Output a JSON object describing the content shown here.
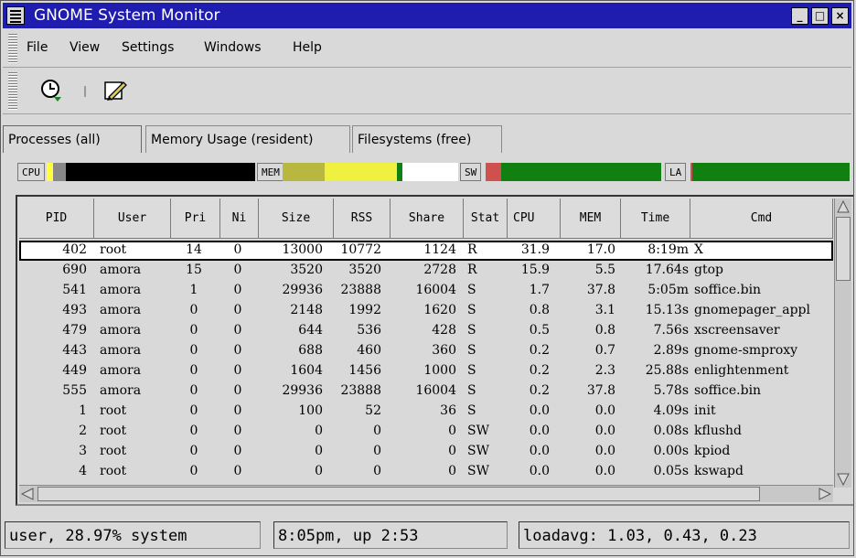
{
  "window": {
    "title": "GNOME System Monitor",
    "controls": [
      "_",
      "□",
      "×"
    ]
  },
  "menubar": {
    "items": [
      {
        "label": "File"
      },
      {
        "label": "View"
      },
      {
        "label": "Settings"
      },
      {
        "label": "Windows"
      },
      {
        "label": "Help"
      }
    ]
  },
  "toolbar": {
    "buttons": [
      {
        "icon": "clock-icon"
      },
      {
        "icon": "pencil-edit-icon"
      }
    ]
  },
  "tabs": [
    {
      "label": "Processes (all)",
      "active": true
    },
    {
      "label": "Memory Usage (resident)",
      "active": false
    },
    {
      "label": "Filesystems (free)",
      "active": false
    }
  ],
  "meters": {
    "cpu": {
      "label": "CPU",
      "user": 0.03,
      "system": 0.06,
      "idle": 0.91,
      "colors": {
        "user": "#ffff40",
        "system": "#888888",
        "idle": "#000000"
      }
    },
    "mem": {
      "label": "MEM",
      "segments": [
        0.24,
        0.41,
        0.03,
        0.32
      ],
      "colors": [
        "#b8b840",
        "#f0f040",
        "#108010",
        "#ffffff"
      ]
    },
    "sw": {
      "label": "SW",
      "used": 0.09,
      "free": 0.91,
      "colors": {
        "used": "#d05050",
        "free": "#108010"
      }
    },
    "la": {
      "label": "LA",
      "used": 0.01,
      "free": 0.99,
      "colors": {
        "used": "#d05050",
        "free": "#108010"
      }
    }
  },
  "table": {
    "columns": [
      "PID",
      "User",
      "Pri",
      "Ni",
      "Size",
      "RSS",
      "Share",
      "Stat",
      "CPU",
      "MEM",
      "Time",
      "Cmd"
    ],
    "sort_icon": "sort-down-icon",
    "rows": [
      [
        "402",
        "root",
        "14",
        "0",
        "13000",
        "10772",
        "1124",
        "R",
        "31.9",
        "17.0",
        "8:19m",
        "X"
      ],
      [
        "690",
        "amora",
        "15",
        "0",
        "3520",
        "3520",
        "2728",
        "R",
        "15.9",
        "5.5",
        "17.64s",
        "gtop"
      ],
      [
        "541",
        "amora",
        "1",
        "0",
        "29936",
        "23888",
        "16004",
        "S",
        "1.7",
        "37.8",
        "5:05m",
        "soffice.bin"
      ],
      [
        "493",
        "amora",
        "0",
        "0",
        "2148",
        "1992",
        "1620",
        "S",
        "0.8",
        "3.1",
        "15.13s",
        "gnomepager_appl"
      ],
      [
        "479",
        "amora",
        "0",
        "0",
        "644",
        "536",
        "428",
        "S",
        "0.5",
        "0.8",
        "7.56s",
        "xscreensaver"
      ],
      [
        "443",
        "amora",
        "0",
        "0",
        "688",
        "460",
        "360",
        "S",
        "0.2",
        "0.7",
        "2.89s",
        "gnome-smproxy"
      ],
      [
        "449",
        "amora",
        "0",
        "0",
        "1604",
        "1456",
        "1000",
        "S",
        "0.2",
        "2.3",
        "25.88s",
        "enlightenment"
      ],
      [
        "555",
        "amora",
        "0",
        "0",
        "29936",
        "23888",
        "16004",
        "S",
        "0.2",
        "37.8",
        "5.78s",
        "soffice.bin"
      ],
      [
        "1",
        "root",
        "0",
        "0",
        "100",
        "52",
        "36",
        "S",
        "0.0",
        "0.0",
        "4.09s",
        "init"
      ],
      [
        "2",
        "root",
        "0",
        "0",
        "0",
        "0",
        "0",
        "SW",
        "0.0",
        "0.0",
        "0.08s",
        "kflushd"
      ],
      [
        "3",
        "root",
        "0",
        "0",
        "0",
        "0",
        "0",
        "SW",
        "0.0",
        "0.0",
        "0.00s",
        "kpiod"
      ],
      [
        "4",
        "root",
        "0",
        "0",
        "0",
        "0",
        "0",
        "SW",
        "0.0",
        "0.0",
        "0.05s",
        "kswapd"
      ]
    ]
  },
  "status": {
    "cpu": "user, 28.97% system",
    "uptime": "8:05pm, up  2:53",
    "loadavg": "loadavg: 1.03, 0.43, 0.23"
  }
}
